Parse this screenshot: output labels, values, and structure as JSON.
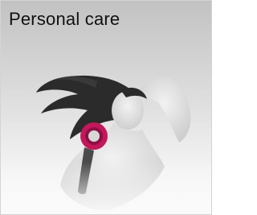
{
  "tile": {
    "title": "Personal care",
    "image_subject": "woman-with-hair-dryer",
    "colors": {
      "dryer_accent": "#c2185b",
      "dryer_body": "#4a4a4a",
      "hair": "#2b2b2b"
    }
  }
}
